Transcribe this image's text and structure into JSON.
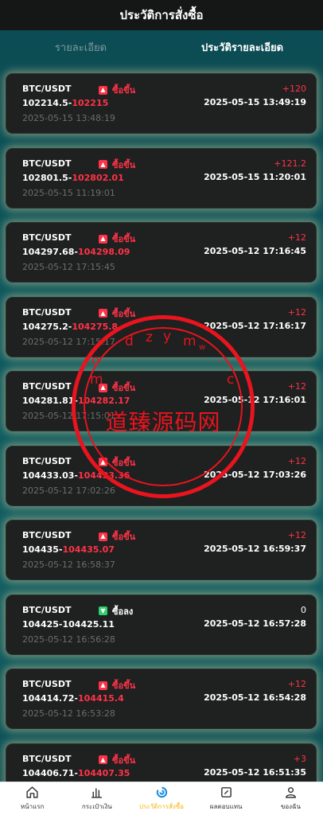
{
  "header": {
    "title": "ประวัติการสั่งซื้อ"
  },
  "tabs": [
    {
      "label": "รายละเอียด",
      "active": false
    },
    {
      "label": "ประวัติรายละเอียด",
      "active": true
    }
  ],
  "orders": [
    {
      "pair": "BTC/USDT",
      "direction": "ซื้อขึ้น",
      "dir": "up",
      "open_price": "102214.5-",
      "close_price": "102215",
      "open_time": "2025-05-15 13:48:19",
      "profit": "+120",
      "close_time": "2025-05-15 13:49:19"
    },
    {
      "pair": "BTC/USDT",
      "direction": "ซื้อขึ้น",
      "dir": "up",
      "open_price": "102801.5-",
      "close_price": "102802.01",
      "open_time": "2025-05-15 11:19:01",
      "profit": "+121.2",
      "close_time": "2025-05-15 11:20:01"
    },
    {
      "pair": "BTC/USDT",
      "direction": "ซื้อขึ้น",
      "dir": "up",
      "open_price": "104297.68-",
      "close_price": "104298.09",
      "open_time": "2025-05-12 17:15:45",
      "profit": "+12",
      "close_time": "2025-05-12 17:16:45"
    },
    {
      "pair": "BTC/USDT",
      "direction": "ซื้อขึ้น",
      "dir": "up",
      "open_price": "104275.2-",
      "close_price": "104275.8",
      "open_time": "2025-05-12 17:15:17",
      "profit": "+12",
      "close_time": "2025-05-12 17:16:17"
    },
    {
      "pair": "BTC/USDT",
      "direction": "ซื้อขึ้น",
      "dir": "up",
      "open_price": "104281.81-",
      "close_price": "104282.17",
      "open_time": "2025-05-12 17:15:01",
      "profit": "+12",
      "close_time": "2025-05-12 17:16:01"
    },
    {
      "pair": "BTC/USDT",
      "direction": "ซื้อขึ้น",
      "dir": "up",
      "open_price": "104433.03-",
      "close_price": "104433.36",
      "open_time": "2025-05-12 17:02:26",
      "profit": "+12",
      "close_time": "2025-05-12 17:03:26"
    },
    {
      "pair": "BTC/USDT",
      "direction": "ซื้อขึ้น",
      "dir": "up",
      "open_price": "104435-",
      "close_price": "104435.07",
      "open_time": "2025-05-12 16:58:37",
      "profit": "+12",
      "close_time": "2025-05-12 16:59:37"
    },
    {
      "pair": "BTC/USDT",
      "direction": "ซื้อลง",
      "dir": "down",
      "open_price": "104425-",
      "close_price": "104425.11",
      "open_time": "2025-05-12 16:56:28",
      "profit": "0",
      "close_time": "2025-05-12 16:57:28"
    },
    {
      "pair": "BTC/USDT",
      "direction": "ซื้อขึ้น",
      "dir": "up",
      "open_price": "104414.72-",
      "close_price": "104415.4",
      "open_time": "2025-05-12 16:53:28",
      "profit": "+12",
      "close_time": "2025-05-12 16:54:28"
    },
    {
      "pair": "BTC/USDT",
      "direction": "ซื้อขึ้น",
      "dir": "up",
      "open_price": "104406.71-",
      "close_price": "104407.35",
      "open_time": "",
      "profit": "+3",
      "close_time": "2025-05-12 16:51:35"
    }
  ],
  "watermark": {
    "text": "道臻源码网",
    "letters": "dzymw.com",
    "color": "#e8141e"
  },
  "nav": [
    {
      "label": "หน้าแรก",
      "icon": "home-icon",
      "active": false
    },
    {
      "label": "กระเป๋าเงิน",
      "icon": "chart-bars-icon",
      "active": false
    },
    {
      "label": "ประวัติการสั่งซื้อ",
      "icon": "order-history-icon",
      "active": true
    },
    {
      "label": "ผลตอบแทน",
      "icon": "edit-box-icon",
      "active": false
    },
    {
      "label": "ของฉัน",
      "icon": "user-icon",
      "active": false
    }
  ],
  "colors": {
    "up": "#ff3347",
    "down": "#2bd26b",
    "accent": "#f2b50f",
    "card": "#1f2020"
  }
}
